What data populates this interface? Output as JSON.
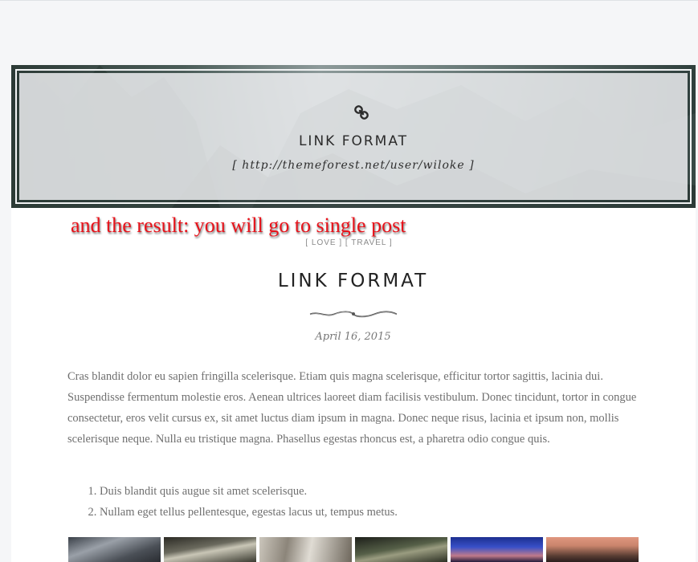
{
  "banner": {
    "icon": "link-icon",
    "title": "LINK FORMAT",
    "url": "[ http://themeforest.net/user/wiloke ]"
  },
  "annotation": {
    "text": "and the result: you will go to single post",
    "color": "#e8121a"
  },
  "post": {
    "categories": "[ LOVE ] [ TRAVEL ]",
    "title": "LINK FORMAT",
    "divider_icon": "ornament-divider-icon",
    "date": "April 16, 2015",
    "body": "Cras blandit dolor eu sapien fringilla scelerisque. Etiam quis magna scelerisque, efficitur tortor sagittis, lacinia dui. Suspendisse fermentum molestie eros. Aenean ultrices laoreet diam facilisis vestibulum. Donec tincidunt, tortor in congue consectetur, eros velit cursus ex, sit amet luctus diam ipsum in magna. Donec neque risus, lacinia et ipsum non, mollis scelerisque neque. Nulla eu tristique magna. Phasellus egestas rhoncus est, a pharetra odio congue quis.",
    "list": [
      "Duis blandit quis augue sit amet scelerisque.",
      "Nullam eget tellus pellentesque, egestas lacus ut, tempus metus."
    ]
  }
}
